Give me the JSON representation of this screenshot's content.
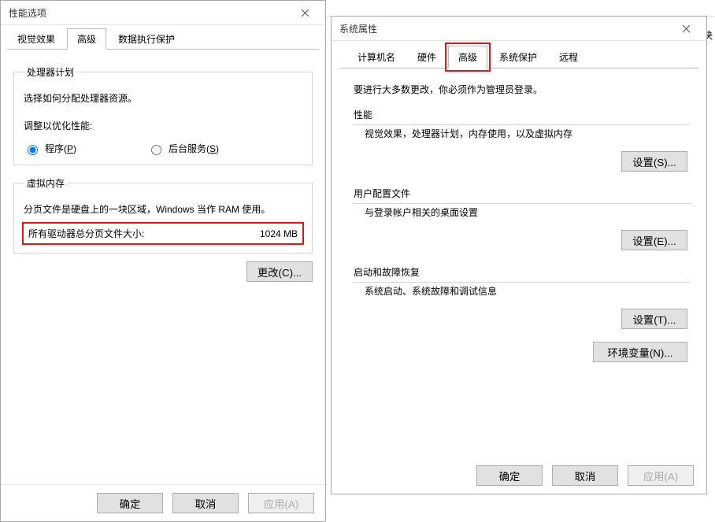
{
  "left": {
    "title": "性能选项",
    "tabs": {
      "visual": "视觉效果",
      "advanced": "高级",
      "dep": "数据执行保护"
    },
    "processorGroup": {
      "legend": "处理器计划",
      "prompt": "选择如何分配处理器资源。",
      "adjustLabel": "调整以优化性能:",
      "programsLabel": "程序(",
      "programsKey": "P",
      "programsTail": ")",
      "bgLabel": "后台服务(",
      "bgKey": "S",
      "bgTail": ")"
    },
    "vmemGroup": {
      "legend": "虚拟内存",
      "desc": "分页文件是硬盘上的一块区域，Windows 当作 RAM 使用。",
      "totalLabel": "所有驱动器总分页文件大小:",
      "totalValue": "1024 MB",
      "changeBtn": "更改(C)..."
    },
    "buttons": {
      "ok": "确定",
      "cancel": "取消",
      "apply": "应用(A)"
    }
  },
  "right": {
    "title": "系统属性",
    "stray": "决",
    "tabs": {
      "computerName": "计算机名",
      "hardware": "硬件",
      "advanced": "高级",
      "systemProtection": "系统保护",
      "remote": "远程"
    },
    "adminNote": "要进行大多数更改，你必须作为管理员登录。",
    "perf": {
      "hdr": "性能",
      "desc": "视觉效果，处理器计划，内存使用，以及虚拟内存",
      "btn": "设置(S)..."
    },
    "profile": {
      "hdr": "用户配置文件",
      "desc": "与登录帐户相关的桌面设置",
      "btn": "设置(E)..."
    },
    "startup": {
      "hdr": "启动和故障恢复",
      "desc": "系统启动、系统故障和调试信息",
      "btn": "设置(T)..."
    },
    "envBtn": "环境变量(N)...",
    "buttons": {
      "ok": "确定",
      "cancel": "取消",
      "apply": "应用(A)"
    }
  }
}
